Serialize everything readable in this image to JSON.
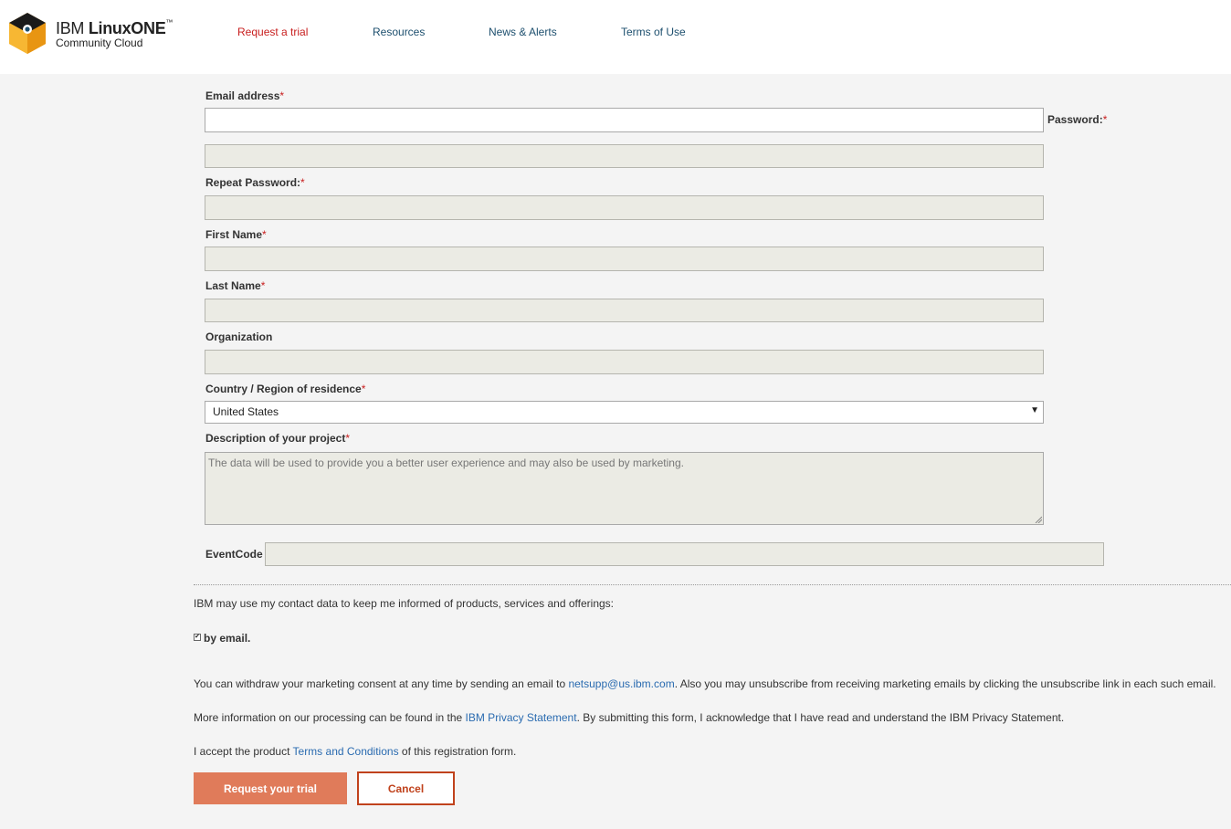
{
  "brand": {
    "line1_ibm": "IBM ",
    "line1_product": "LinuxONE",
    "trademark": "™",
    "line2": "Community Cloud"
  },
  "nav": {
    "items": [
      {
        "label": "Request a trial"
      },
      {
        "label": "Resources"
      },
      {
        "label": "News & Alerts"
      },
      {
        "label": "Terms of Use"
      }
    ]
  },
  "colors": {
    "accent_red": "#c81e1e",
    "nav_link": "#1d4f6e",
    "primary_button": "#e07b5a",
    "link": "#2a6bb0"
  },
  "form": {
    "required_mark": "*",
    "email": {
      "label": "Email address",
      "value": ""
    },
    "password": {
      "label": "Password:",
      "value": ""
    },
    "repeat_password": {
      "label": "Repeat Password:",
      "value": ""
    },
    "first_name": {
      "label": "First Name",
      "value": ""
    },
    "last_name": {
      "label": "Last Name",
      "value": ""
    },
    "organization": {
      "label": "Organization",
      "value": ""
    },
    "country": {
      "label": "Country / Region of residence",
      "selected": "United States",
      "arrow": "▼"
    },
    "description": {
      "label": "Description of your project",
      "placeholder": "The data will be used to provide you a better user experience and may also be used by marketing."
    },
    "event_code": {
      "label": "EventCode",
      "value": ""
    }
  },
  "consent": {
    "intro": "IBM may use my contact data to keep me informed of products, services and offerings:",
    "by_email_label": "by email.",
    "by_email_checked": true,
    "check_glyph": "✔",
    "withdraw_pre": "You can withdraw your marketing consent at any time by sending an email to ",
    "withdraw_link": "netsupp@us.ibm.com",
    "withdraw_post": ". Also you may unsubscribe from receiving marketing emails by clicking the unsubscribe link in each such email.",
    "privacy_pre": "More information on our processing can be found in the ",
    "privacy_link": "IBM Privacy Statement",
    "privacy_post": ". By submitting this form, I acknowledge that I have read and understand the IBM Privacy Statement.",
    "terms_pre": "I accept the product ",
    "terms_link": "Terms and Conditions",
    "terms_post": " of this registration form."
  },
  "buttons": {
    "submit": "Request your trial",
    "cancel": "Cancel"
  }
}
